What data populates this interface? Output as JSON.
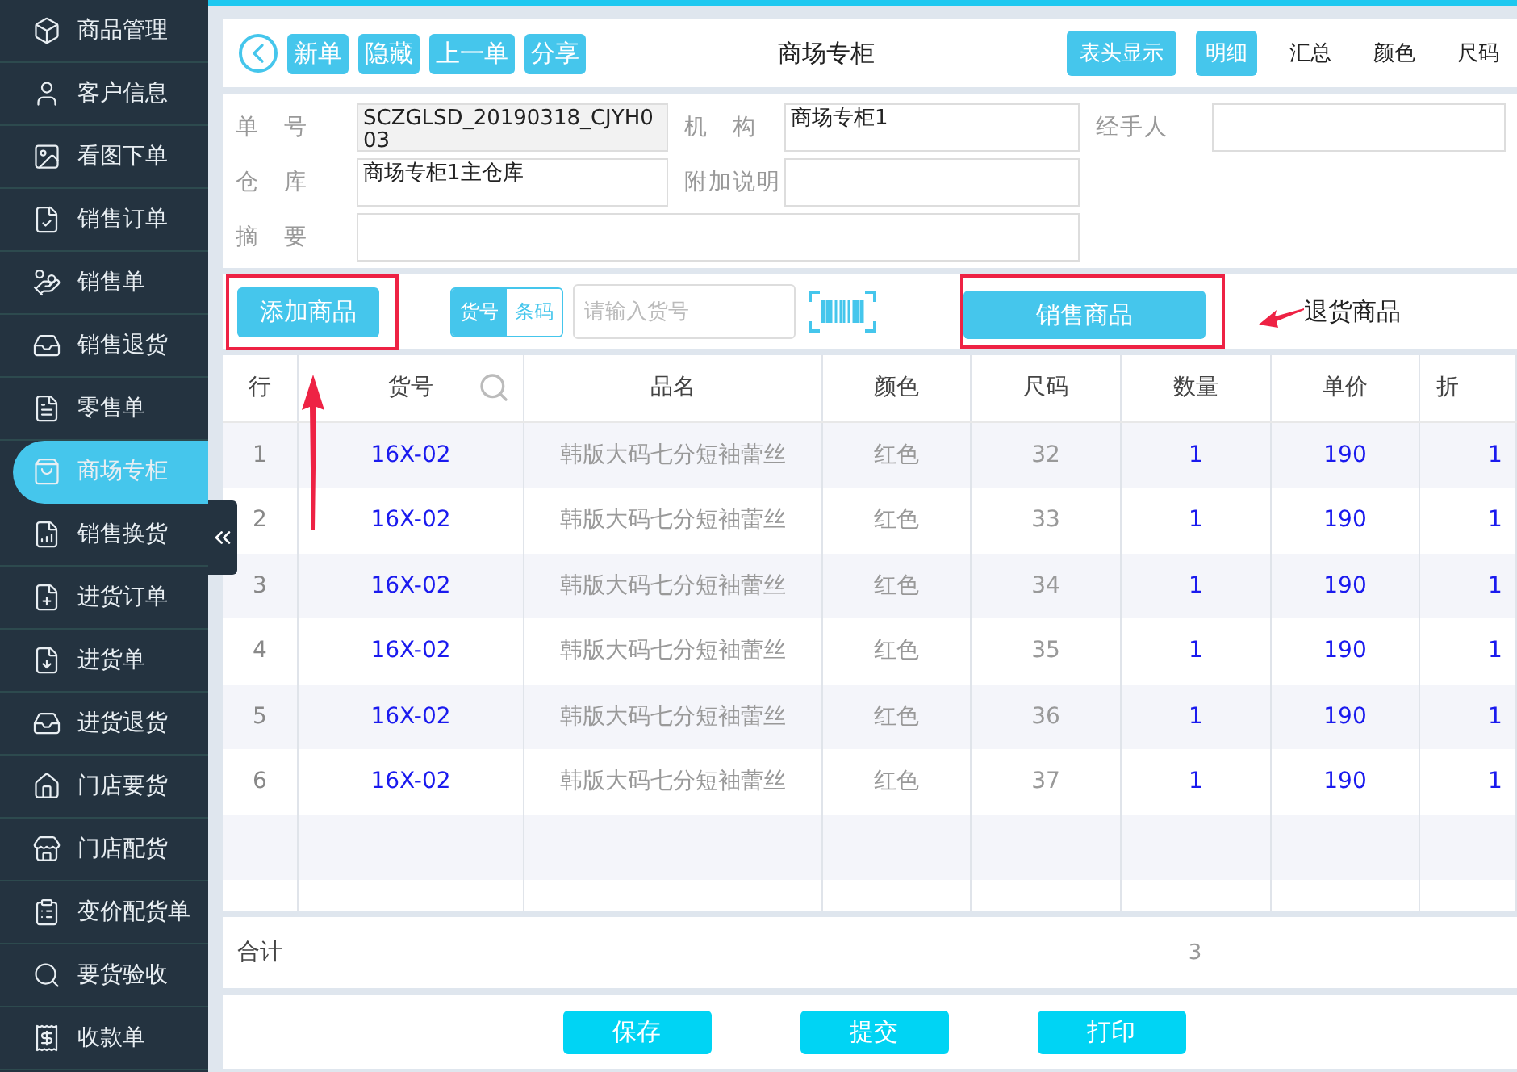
{
  "sidebar": {
    "items": [
      {
        "label": "商品管理",
        "selected": false
      },
      {
        "label": "客户信息",
        "selected": false
      },
      {
        "label": "看图下单",
        "selected": false
      },
      {
        "label": "销售订单",
        "selected": false
      },
      {
        "label": "销售单",
        "selected": false
      },
      {
        "label": "销售退货",
        "selected": false
      },
      {
        "label": "零售单",
        "selected": false
      },
      {
        "label": "商场专柜",
        "selected": true
      },
      {
        "label": "销售换货",
        "selected": false
      },
      {
        "label": "进货订单",
        "selected": false
      },
      {
        "label": "进货单",
        "selected": false
      },
      {
        "label": "进货退货",
        "selected": false
      },
      {
        "label": "门店要货",
        "selected": false
      },
      {
        "label": "门店配货",
        "selected": false
      },
      {
        "label": "变价配货单",
        "selected": false
      },
      {
        "label": "要货验收",
        "selected": false
      },
      {
        "label": "收款单",
        "selected": false
      }
    ]
  },
  "toolbar": {
    "buttons": [
      "新单",
      "隐藏",
      "上一单",
      "分享"
    ],
    "title": "商场专柜",
    "view_button": "表头显示",
    "view_tabs": [
      {
        "label": "明细",
        "selected": true
      },
      {
        "label": "汇总",
        "selected": false
      },
      {
        "label": "颜色",
        "selected": false
      },
      {
        "label": "尺码",
        "selected": false
      }
    ]
  },
  "form": {
    "fields": [
      {
        "label": "单　号",
        "value": "SCZGLSD_20190318_CJYH003",
        "disabled": true
      },
      {
        "label": "机　构",
        "value": "商场专柜1",
        "disabled": false
      },
      {
        "label": "经手人",
        "disabled": false
      },
      {
        "label": "仓　库",
        "value": "商场专柜1主仓库",
        "disabled": false
      },
      {
        "label": "附加说明",
        "disabled": false
      }
    ],
    "summary": {
      "label": "摘　要"
    }
  },
  "entry_bar": {
    "add_button": "添加商品",
    "search_modes": [
      {
        "label": "货号",
        "selected": true
      },
      {
        "label": "条码",
        "selected": false
      }
    ],
    "search": {
      "placeholder": "请输入货号"
    },
    "product_tabs": [
      {
        "label": "销售商品",
        "selected": true
      },
      {
        "label": "退货商品",
        "selected": false
      }
    ]
  },
  "table": {
    "columns": [
      "行",
      "货号",
      "品名",
      "颜色",
      "尺码",
      "数量",
      "单价",
      "折"
    ],
    "rows": [
      [
        "1",
        "16X-02",
        "韩版大码七分短袖蕾丝",
        "红色",
        "32",
        "1",
        "190",
        "1"
      ],
      [
        "2",
        "16X-02",
        "韩版大码七分短袖蕾丝",
        "红色",
        "33",
        "1",
        "190",
        "1"
      ],
      [
        "3",
        "16X-02",
        "韩版大码七分短袖蕾丝",
        "红色",
        "34",
        "1",
        "190",
        "1"
      ],
      [
        "4",
        "16X-02",
        "韩版大码七分短袖蕾丝",
        "红色",
        "35",
        "1",
        "190",
        "1"
      ],
      [
        "5",
        "16X-02",
        "韩版大码七分短袖蕾丝",
        "红色",
        "36",
        "1",
        "190",
        "1"
      ],
      [
        "6",
        "16X-02",
        "韩版大码七分短袖蕾丝",
        "红色",
        "37",
        "1",
        "190",
        "1"
      ]
    ],
    "total_label": "合计",
    "total_quantity": "3"
  },
  "footer": {
    "buttons": [
      "保存",
      "提交",
      "打印"
    ]
  }
}
